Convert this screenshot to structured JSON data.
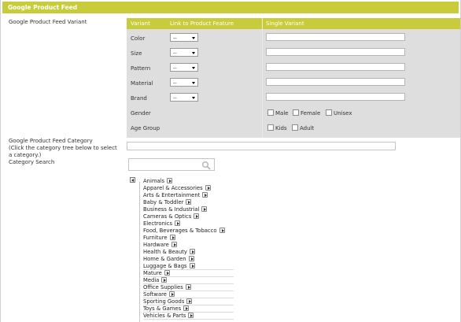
{
  "panel": {
    "title": "Google Product Feed"
  },
  "variant_section": {
    "label": "Google Product Feed Variant",
    "headers": [
      "Variant",
      "Link to Product Feature",
      "Single Variant"
    ],
    "rows": [
      {
        "label": "Color",
        "select": "--"
      },
      {
        "label": "Size",
        "select": "--"
      },
      {
        "label": "Pattern",
        "select": "--"
      },
      {
        "label": "Material",
        "select": "--"
      },
      {
        "label": "Brand",
        "select": "--"
      }
    ],
    "gender": {
      "label": "Gender",
      "options": [
        "Male",
        "Female",
        "Unisex"
      ]
    },
    "age_group": {
      "label": "Age Group",
      "options": [
        "Kids",
        "Adult"
      ]
    }
  },
  "category_section": {
    "label_line1": "Google Product Feed Category",
    "label_line2": "(Click the category tree below to select",
    "label_line3": "a category.)",
    "input_value": ""
  },
  "category_search": {
    "label": "Category Search",
    "value": ""
  },
  "category_tree": [
    "Animals",
    "Apparel & Accessories",
    "Arts & Entertainment",
    "Baby & Toddler",
    "Business & Industrial",
    "Cameras & Optics",
    "Electronics",
    "Food, Beverages & Tobacco",
    "Furniture",
    "Hardware",
    "Health & Beauty",
    "Home & Garden",
    "Luggage & Bags",
    "Mature",
    "Media",
    "Office Supplies",
    "Software",
    "Sporting Goods",
    "Toys & Games",
    "Vehicles & Parts"
  ],
  "colors": {
    "accent": "#c8cc3a",
    "table_bg": "#dedede"
  }
}
